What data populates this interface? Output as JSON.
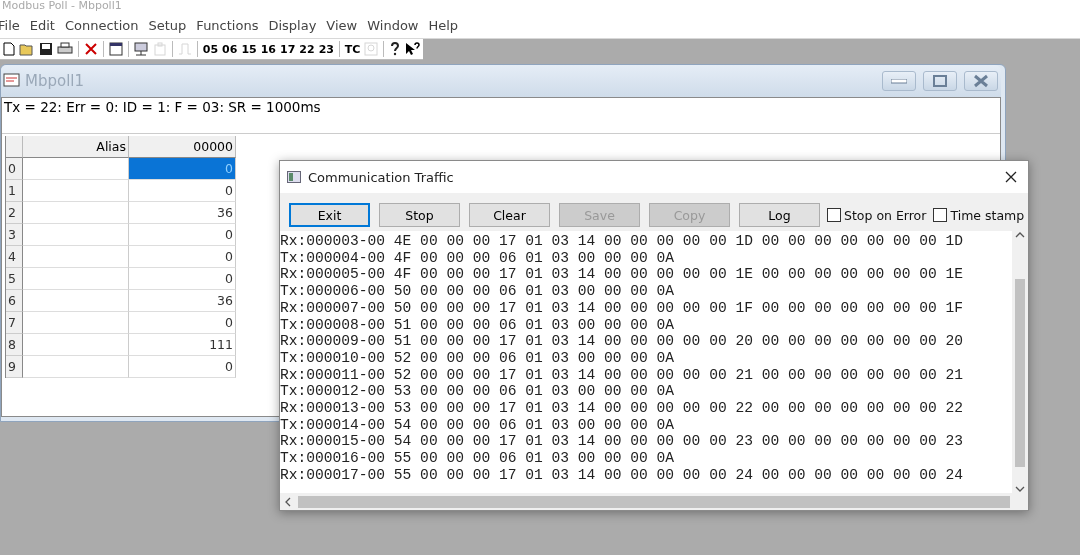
{
  "app": {
    "title": "Modbus Poll - Mbpoll1"
  },
  "menu": [
    "File",
    "Edit",
    "Connection",
    "Setup",
    "Functions",
    "Display",
    "View",
    "Window",
    "Help"
  ],
  "toolbar": [
    {
      "kind": "icon",
      "disabled": false
    },
    {
      "kind": "icon",
      "disabled": false
    },
    {
      "kind": "icon",
      "disabled": false
    },
    {
      "kind": "icon",
      "disabled": false
    },
    {
      "kind": "separator"
    },
    {
      "kind": "icon",
      "disabled": false
    },
    {
      "kind": "separator"
    },
    {
      "kind": "icon",
      "disabled": false
    },
    {
      "kind": "separator"
    },
    {
      "kind": "icon",
      "disabled": false
    },
    {
      "kind": "icon",
      "disabled": true
    },
    {
      "kind": "separator"
    },
    {
      "kind": "icon",
      "disabled": true
    },
    {
      "kind": "separator"
    },
    {
      "kind": "text",
      "label": "05"
    },
    {
      "kind": "text",
      "label": "06"
    },
    {
      "kind": "text",
      "label": "15"
    },
    {
      "kind": "text",
      "label": "16"
    },
    {
      "kind": "text",
      "label": "17"
    },
    {
      "kind": "text",
      "label": "22"
    },
    {
      "kind": "text",
      "label": "23"
    },
    {
      "kind": "separator"
    },
    {
      "kind": "text",
      "label": "TC"
    },
    {
      "kind": "icon",
      "disabled": true
    },
    {
      "kind": "separator"
    },
    {
      "kind": "icon",
      "disabled": false
    },
    {
      "kind": "icon",
      "disabled": false
    }
  ],
  "child_window": {
    "title": "Mbpoll1",
    "status": "Tx = 22: Err = 0: ID = 1: F = 03: SR = 1000ms",
    "table": {
      "columns": [
        "Alias",
        "00000"
      ],
      "rows": [
        {
          "index": "0",
          "value": "0",
          "selected": true
        },
        {
          "index": "1",
          "value": "0",
          "selected": false
        },
        {
          "index": "2",
          "value": "36",
          "selected": false
        },
        {
          "index": "3",
          "value": "0",
          "selected": false
        },
        {
          "index": "4",
          "value": "0",
          "selected": false
        },
        {
          "index": "5",
          "value": "0",
          "selected": false
        },
        {
          "index": "6",
          "value": "36",
          "selected": false
        },
        {
          "index": "7",
          "value": "0",
          "selected": false
        },
        {
          "index": "8",
          "value": "111",
          "selected": false
        },
        {
          "index": "9",
          "value": "0",
          "selected": false
        }
      ]
    }
  },
  "dialog": {
    "title": "Communication Traffic",
    "buttons": [
      {
        "label": "Exit",
        "disabled": false,
        "focused": true
      },
      {
        "label": "Stop",
        "disabled": false,
        "focused": false
      },
      {
        "label": "Clear",
        "disabled": false,
        "focused": false
      },
      {
        "label": "Save",
        "disabled": true,
        "focused": false
      },
      {
        "label": "Copy",
        "disabled": true,
        "focused": false
      },
      {
        "label": "Log",
        "disabled": false,
        "focused": false
      }
    ],
    "checkboxes": [
      {
        "label": "Stop on Error",
        "checked": false
      },
      {
        "label": "Time stamp",
        "checked": false
      }
    ],
    "lines": [
      "Rx:000003-00 4E 00 00 00 17 01 03 14 00 00 00 00 00 1D 00 00 00 00 00 00 00 1D",
      "Tx:000004-00 4F 00 00 00 06 01 03 00 00 00 0A",
      "Rx:000005-00 4F 00 00 00 17 01 03 14 00 00 00 00 00 1E 00 00 00 00 00 00 00 1E",
      "Tx:000006-00 50 00 00 00 06 01 03 00 00 00 0A",
      "Rx:000007-00 50 00 00 00 17 01 03 14 00 00 00 00 00 1F 00 00 00 00 00 00 00 1F",
      "Tx:000008-00 51 00 00 00 06 01 03 00 00 00 0A",
      "Rx:000009-00 51 00 00 00 17 01 03 14 00 00 00 00 00 20 00 00 00 00 00 00 00 20",
      "Tx:000010-00 52 00 00 00 06 01 03 00 00 00 0A",
      "Rx:000011-00 52 00 00 00 17 01 03 14 00 00 00 00 00 21 00 00 00 00 00 00 00 21",
      "Tx:000012-00 53 00 00 00 06 01 03 00 00 00 0A",
      "Rx:000013-00 53 00 00 00 17 01 03 14 00 00 00 00 00 22 00 00 00 00 00 00 00 22",
      "Tx:000014-00 54 00 00 00 06 01 03 00 00 00 0A",
      "Rx:000015-00 54 00 00 00 17 01 03 14 00 00 00 00 00 23 00 00 00 00 00 00 00 23",
      "Tx:000016-00 55 00 00 00 06 01 03 00 00 00 0A",
      "Rx:000017-00 55 00 00 00 17 01 03 14 00 00 00 00 00 24 00 00 00 00 00 00 00 24"
    ]
  }
}
